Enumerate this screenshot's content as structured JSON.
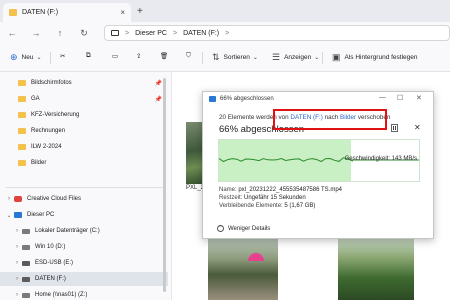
{
  "tab": {
    "title": "DATEN (F:)",
    "close": "×",
    "new": "+"
  },
  "nav": {
    "back": "←",
    "forward": "→",
    "up": "↑",
    "refresh": "↻"
  },
  "address": {
    "segments": [
      "Dieser PC",
      "DATEN (F:)"
    ],
    "separator": ">"
  },
  "toolbar": {
    "new_label": "Neu",
    "sort_label": "Sortieren",
    "view_label": "Anzeigen",
    "background_label": "Als Hintergrund festlegen"
  },
  "sidebar": {
    "pinned": [
      {
        "label": "Bildschirmfotos",
        "pin": true
      },
      {
        "label": "GA",
        "pin": true
      },
      {
        "label": "KFZ-Versicherung",
        "pin": false
      },
      {
        "label": "Rechnungen",
        "pin": false
      },
      {
        "label": "ILW 2-2024",
        "pin": false
      },
      {
        "label": "Bilder",
        "pin": false
      }
    ],
    "tree": [
      {
        "label": "Creative Cloud Files"
      },
      {
        "label": "Dieser PC"
      },
      {
        "label": "Lokaler Datenträger (C:)"
      },
      {
        "label": "Win 10 (D:)"
      },
      {
        "label": "ESD-USB (E:)"
      },
      {
        "label": "DATEN (F:)"
      },
      {
        "label": "Home (\\\\nas01) (Z:)"
      }
    ]
  },
  "content": {
    "file_label": "PXL_2"
  },
  "dialog": {
    "title": "66% abgeschlossen",
    "line_prefix": "20 Elemente werden von",
    "line_source": "DATEN (F:)",
    "line_mid": "nach",
    "line_target": "Bilder",
    "line_suffix": "verschoben",
    "percent_text": "66% abgeschlossen",
    "progress": 0.66,
    "speed_label": "Geschwindigkeit: 143 MB/s",
    "name_label": "Name:",
    "name_value": "pxl_20231222_455535487586 TS.mp4",
    "remaining_label": "Restzeit:",
    "remaining_value": "Ungefähr 15 Sekunden",
    "items_label": "Verbleibende Elemente:",
    "items_value": "5 (1,67 GB)",
    "less_details": "Weniger Details",
    "colors": {
      "graph_fill": "#c9efc4",
      "graph_line": "#2b8a2b",
      "highlight": "#e01212"
    }
  }
}
